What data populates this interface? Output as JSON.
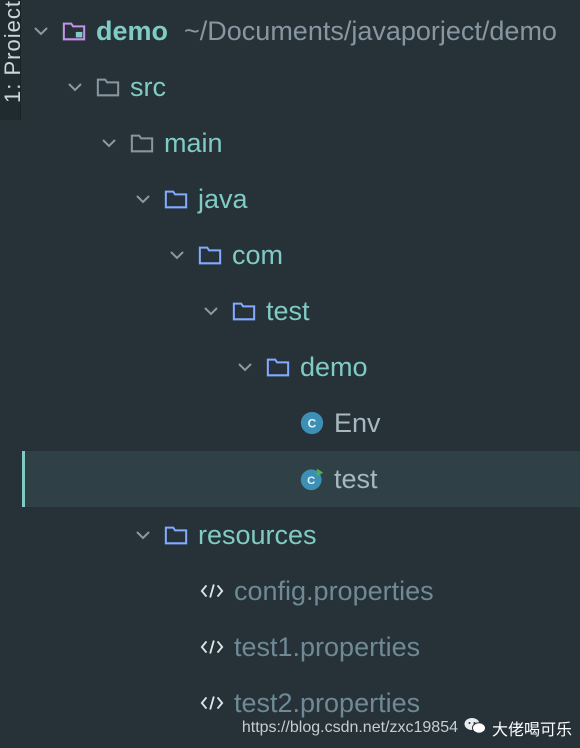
{
  "side_panel": {
    "tab_label": "1: Project"
  },
  "tree": {
    "root": {
      "label": "demo",
      "path": "~/Documents/javaporject/demo"
    },
    "items": [
      {
        "label": "src"
      },
      {
        "label": "main"
      },
      {
        "label": "java"
      },
      {
        "label": "com"
      },
      {
        "label": "test"
      },
      {
        "label": "demo"
      },
      {
        "label": "Env",
        "icon": "class-icon"
      },
      {
        "label": "test",
        "icon": "runnable-class-icon",
        "selected": true
      },
      {
        "label": "resources"
      },
      {
        "label": "config.properties",
        "icon": "properties-file-icon"
      },
      {
        "label": "test1.properties",
        "icon": "properties-file-icon"
      },
      {
        "label": "test2.properties",
        "icon": "properties-file-icon"
      }
    ]
  },
  "watermark": {
    "url": "https://blog.csdn.net/zxc19854",
    "brand": "大佬喝可乐"
  },
  "colors": {
    "background": "#263238",
    "selection": "#2f4047",
    "accent": "#80cbc4",
    "source_folder": "#82aaff",
    "module": "#c792ea"
  }
}
